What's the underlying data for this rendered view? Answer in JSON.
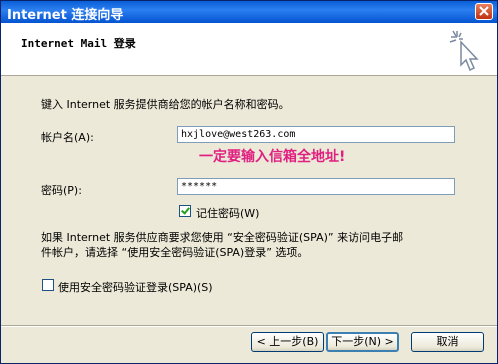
{
  "window": {
    "title": "Internet 连接向导"
  },
  "header": {
    "title": "Internet Mail 登录"
  },
  "intro": "键入 Internet 服务提供商给您的帐户名称和密码。",
  "account": {
    "label": "帐户名(A):",
    "value": "hxjlove@west263.com",
    "note": "一定要输入信箱全地址!"
  },
  "password": {
    "label": "密码(P):",
    "value": "******",
    "remember_label": "记住密码(W)",
    "remember_checked": true
  },
  "spa_info": {
    "line1": "如果 Internet 服务供应商要求您使用 “安全密码验证(SPA)” 来访问电子邮",
    "line2": "件帐户，请选择 “使用安全密码验证(SPA)登录” 选项。"
  },
  "spa_checkbox": {
    "label": "使用安全密码验证登录(SPA)(S)",
    "checked": false
  },
  "buttons": {
    "back": "< 上一步(B)",
    "next": "下一步(N) >",
    "cancel": "取消"
  },
  "icons": {
    "close": "close-icon",
    "wizard": "wizard-sparkle-cursor-icon"
  }
}
